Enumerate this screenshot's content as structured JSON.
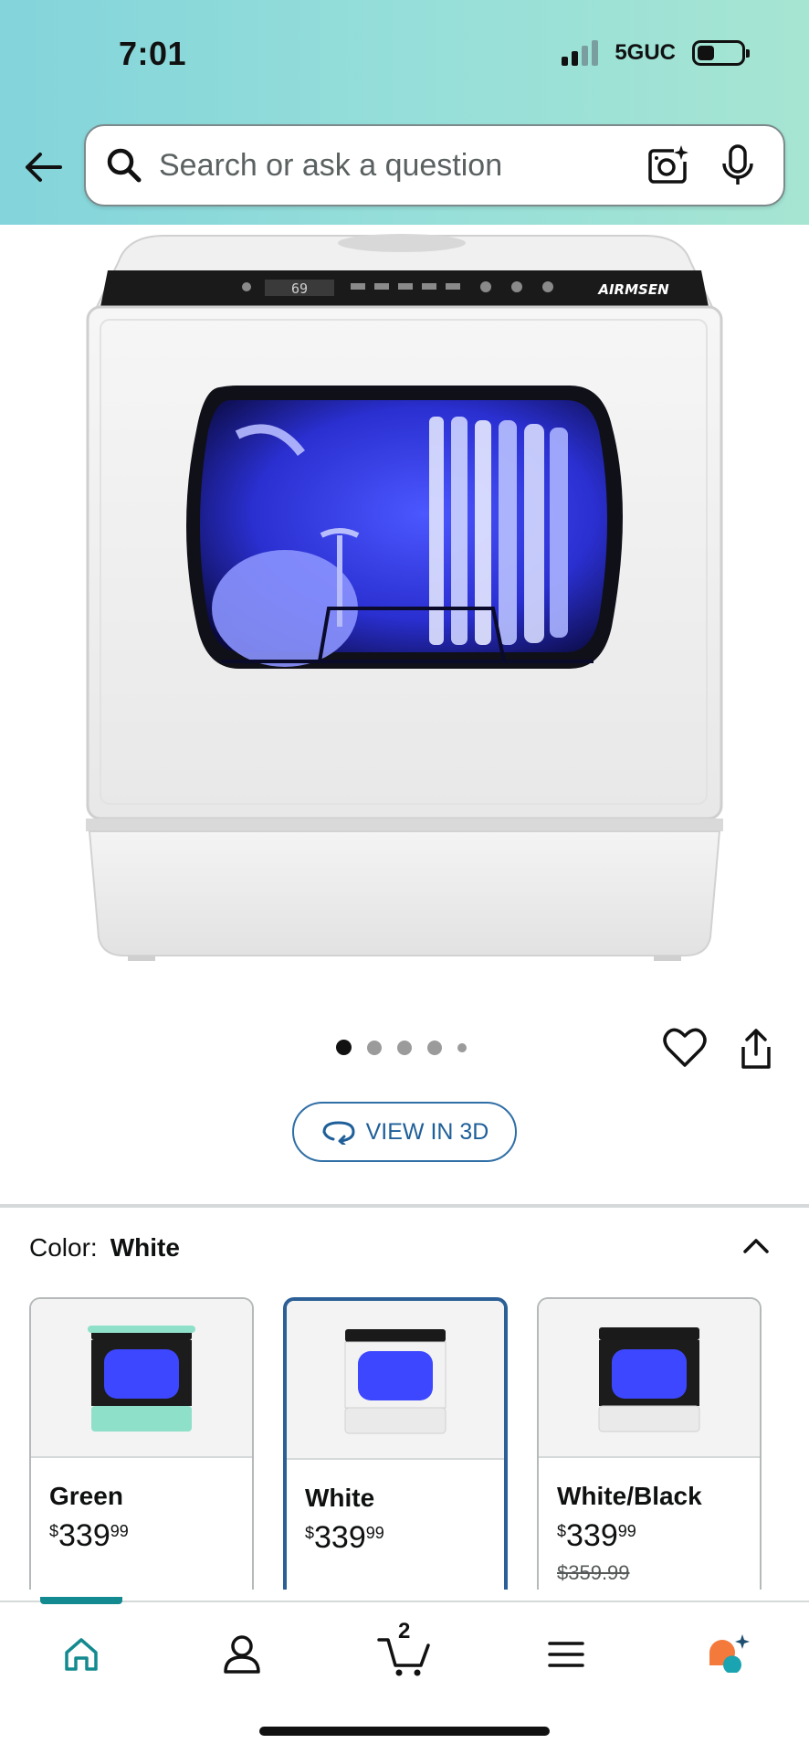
{
  "status_bar": {
    "time": "7:01",
    "network": "5GUC"
  },
  "search": {
    "placeholder": "Search or ask a question"
  },
  "product": {
    "image_brand_text": "AIRMSEN",
    "display_digits": "69",
    "carousel_total": 5,
    "carousel_active": 1
  },
  "view_3d": {
    "label": "VIEW IN 3D"
  },
  "color_selector": {
    "label": "Color:",
    "selected": "White",
    "options": [
      {
        "name": "Green",
        "currency": "$",
        "whole": "339",
        "fraction": "99",
        "list_price": ""
      },
      {
        "name": "White",
        "currency": "$",
        "whole": "339",
        "fraction": "99",
        "list_price": ""
      },
      {
        "name": "White/Black",
        "currency": "$",
        "whole": "339",
        "fraction": "99",
        "list_price": "$359.99"
      }
    ]
  },
  "bottom_nav": {
    "cart_count": "2",
    "active": "home"
  },
  "colors": {
    "header_start": "#83d4db",
    "header_end": "#a6e5d2",
    "link_blue": "#1f5f99",
    "selected_border": "#2b5f96",
    "nav_active": "#138a8f"
  }
}
